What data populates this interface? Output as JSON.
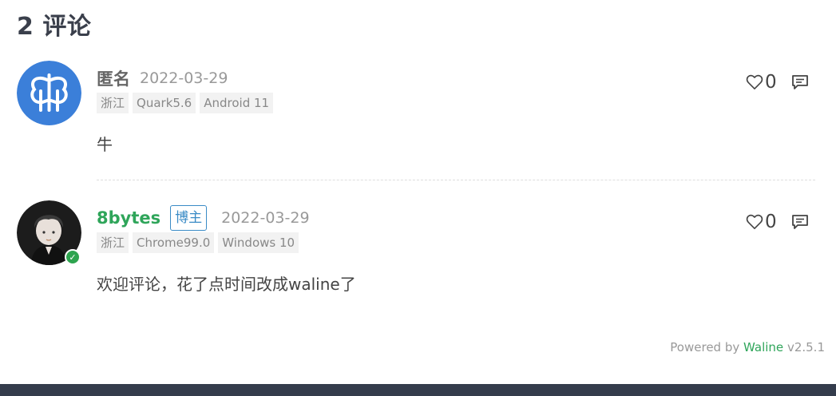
{
  "header": {
    "count": "2",
    "title": "评论"
  },
  "comments": [
    {
      "nick": "匿名",
      "time": "2022-03-29",
      "meta": [
        "浙江",
        "Quark5.6",
        "Android 11"
      ],
      "content": "牛",
      "likes": "0",
      "avatar_icon": "butterfly-logo-avatar",
      "avatar_color": "#3b7fd9"
    },
    {
      "nick": "8bytes",
      "badge": "博主",
      "time": "2022-03-29",
      "meta": [
        "浙江",
        "Chrome99.0",
        "Windows 10"
      ],
      "content": "欢迎评论，花了点时间改成waline了",
      "likes": "0",
      "avatar_icon": "cartoon-person-avatar",
      "verified": true
    }
  ],
  "footer": {
    "powered_by": "Powered by",
    "brand": "Waline",
    "version": "v2.5.1"
  },
  "colors": {
    "accent": "#2fa55a",
    "badge": "#3a8bc6",
    "footer_bar": "#343c4c"
  }
}
